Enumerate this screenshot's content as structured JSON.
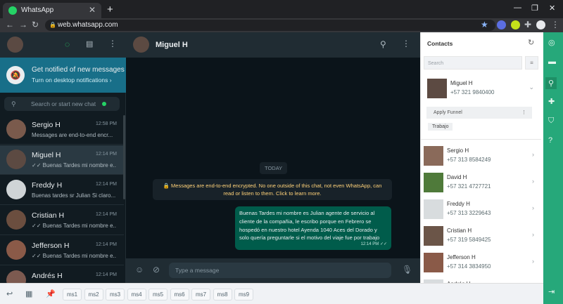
{
  "browser": {
    "tab_title": "WhatsApp",
    "url": "web.whatsapp.com",
    "new_tab": "+",
    "tab_close": "✕"
  },
  "left_panel": {
    "notification": {
      "title": "Get notified of new messages",
      "subtitle": "Turn on desktop notifications ›"
    },
    "search_placeholder": "Search or start new chat",
    "chats": [
      {
        "name": "Sergio H",
        "time": "12:58 PM",
        "preview": "Messages are end-to-end encr...",
        "avatar_color": "#7a5a4c"
      },
      {
        "name": "Miguel H",
        "time": "12:14 PM",
        "preview": "✓✓ Buenas Tardes mi nombre e...",
        "avatar_color": "#5c4a42",
        "selected": true
      },
      {
        "name": "Freddy H",
        "time": "12:14 PM",
        "preview": "Buenas tardes sr Julian Si claro...",
        "avatar_color": "#cfd4d6"
      },
      {
        "name": "Cristian H",
        "time": "12:14 PM",
        "preview": "✓✓ Buenas Tardes mi nombre e...",
        "avatar_color": "#6b4e3f"
      },
      {
        "name": "Jefferson H",
        "time": "12:14 PM",
        "preview": "✓✓ Buenas Tardes mi nombre e...",
        "avatar_color": "#8a5a48"
      },
      {
        "name": "Andrés H",
        "time": "12:14 PM",
        "preview": "✓✓ Buenas Tardes mi nombre e...",
        "avatar_color": "#7c5a50"
      }
    ]
  },
  "conversation": {
    "contact_name": "Miguel H",
    "date_divider": "TODAY",
    "encryption_notice": "🔒 Messages are end-to-end encrypted. No one outside of this chat, not even WhatsApp, can read or listen to them. Click to learn more.",
    "message": {
      "text": "Buenas Tardes mi nombre es Julian agente de servicio al cliente de la compañia, le escribo porque en Febrero se hospedó en nuestro hotel Ayenda 1040 Aces del Dorado y solo quería preguntarle si el motivo del viaje fue por trabajo",
      "time": "12:14 PM ✓✓"
    },
    "input_placeholder": "Type a message"
  },
  "contacts_panel": {
    "title": "Contacts",
    "search_placeholder": "Search",
    "expanded": {
      "name": "Miguel H",
      "phone": "+57 321 9840400",
      "apply_funnel": "Apply Funnel",
      "tag": "Trabajo"
    },
    "list": [
      {
        "name": "Sergio H",
        "phone": "+57 313 8584249",
        "color": "#8a6a5a"
      },
      {
        "name": "David H",
        "phone": "+57 321 4727721",
        "color": "#4f7a3a"
      },
      {
        "name": "Freddy H",
        "phone": "+57 313 3229643",
        "color": "#d8dcde"
      },
      {
        "name": "Cristian H",
        "phone": "+57 319 5849425",
        "color": "#6b5548"
      },
      {
        "name": "Jefferson H",
        "phone": "+57 314 3834950",
        "color": "#8a5a48"
      },
      {
        "name": "Andrés H",
        "phone": "",
        "color": "#d8dcde"
      }
    ]
  },
  "quick_messages": [
    "ms1",
    "ms2",
    "ms3",
    "ms4",
    "ms5",
    "ms6",
    "ms7",
    "ms8",
    "ms9"
  ],
  "colors": {
    "wa_header": "#202c33",
    "wa_notification": "#186f89",
    "bubble_out": "#005c4b",
    "extension_strip": "#26a87a"
  }
}
